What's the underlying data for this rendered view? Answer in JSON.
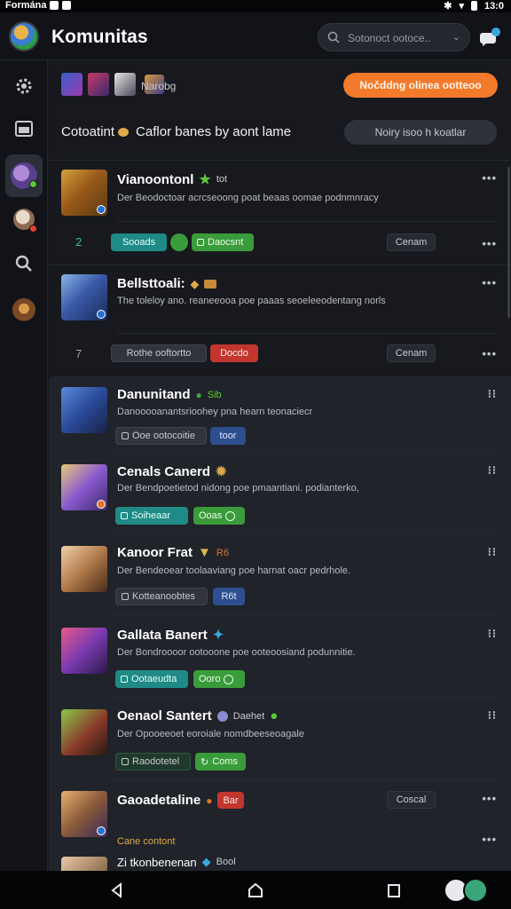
{
  "status_bar": {
    "carrier": "Formána",
    "time": "13:0"
  },
  "header": {
    "title": "Komunitas",
    "search_placeholder": "Sotonoct ootoce..",
    "chat_icon": "chat-bubble-icon"
  },
  "rail": {
    "items": [
      {
        "name": "gear-icon",
        "active": false
      },
      {
        "name": "image-icon",
        "active": false
      },
      {
        "name": "community-avatar",
        "active": true,
        "badge": "#5cc93a"
      },
      {
        "name": "profile-avatar",
        "active": false,
        "badge": "#e0402f"
      },
      {
        "name": "search-icon",
        "active": false
      },
      {
        "name": "game-avatar",
        "active": false
      }
    ]
  },
  "subheader": {
    "thumbs_label": "Narobg",
    "cta_label": "Nočddng olinea ootteoo"
  },
  "section": {
    "heading_a": "Cotoatint",
    "heading_b": "Caflor banes by aont lame",
    "secondary_button": "Noiry isoo h koatlar"
  },
  "posts": [
    {
      "name": "Vianoontonl",
      "tag": "tot",
      "desc": "Der Beodoctoar acrcseoong poat beaas oomae podnmnracy",
      "count": "2",
      "pills": [
        "Sooads",
        "",
        "Daocsnt"
      ],
      "action": "Cenam"
    },
    {
      "name": "Bellsttoali:",
      "tag": "",
      "desc": "The toleloy ano. reaneeooa poe paaas seoeleeodentang norls",
      "count": "7",
      "pills": [
        "Rothe ooftortto",
        "Docdo"
      ],
      "action": "Cenam"
    },
    {
      "name": "Danunitand",
      "tag": "Sib",
      "desc": "Danooooanantsrioohey pna hearn teonaciecr",
      "pills": [
        "Ooe ootocoitie",
        "toor"
      ]
    },
    {
      "name": "Cenals Canerd",
      "tag": "",
      "desc": "Der Bendpoetietod nidong poe pmaantiani. podianterko,",
      "pills": [
        "Soiheaar",
        "Ooas"
      ]
    },
    {
      "name": "Kanoor Frat",
      "tag": "R6",
      "desc": "Der Bendeoear toolaaviang poe harnat oacr pedrhole.",
      "pills": [
        "Kotteanoobtes",
        "R6t"
      ]
    },
    {
      "name": "Gallata Banert",
      "tag": "",
      "desc": "Der Bondroooor ootooone poe ooteoosiand podunnitie.",
      "pills": [
        "Ootaeudta",
        "Ooro"
      ]
    },
    {
      "name": "Oenaol Santert",
      "tag": "Daehet",
      "desc": "Der Opooeeoet eoroiale nomdbeeseoagale",
      "pills": [
        "Raodotetel",
        "Coms"
      ]
    },
    {
      "name": "Gaoadetaline",
      "tag": "Bar",
      "desc": "Cane contont",
      "action": "Coscal"
    },
    {
      "name": "Zi tkonbenenan",
      "tag": "Bool",
      "desc": ""
    }
  ],
  "colors": {
    "accent_orange": "#f37a2b",
    "teal": "#1f8a86",
    "green": "#3a9b3a",
    "red": "#c2362e",
    "blue": "#2e4f8f"
  }
}
